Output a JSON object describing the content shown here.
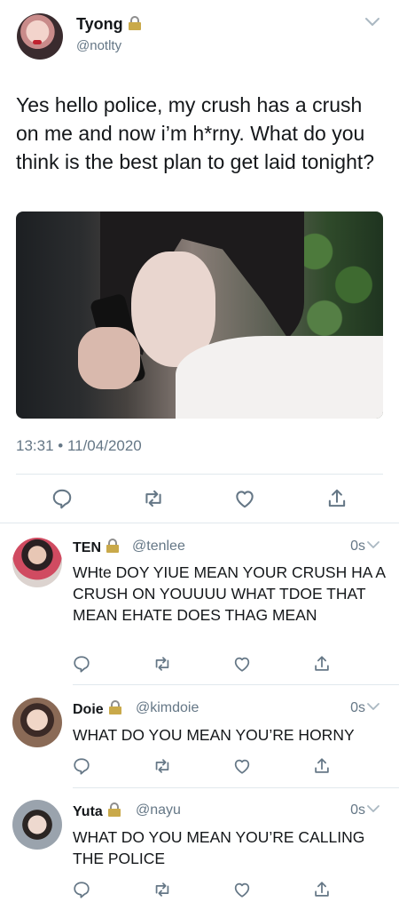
{
  "tweet": {
    "author_name": "Tyong",
    "author_handle": "@notlty",
    "text": "Yes hello police, my crush has a crush on me and now i’m h*rny. What do you think is the best plan to get laid tonight?",
    "timestamp": "13:31 • 11/04/2020",
    "icons": [
      "lock-icon",
      "chevron-down-icon",
      "reply-icon",
      "retweet-icon",
      "like-icon",
      "share-icon"
    ]
  },
  "replies": [
    {
      "name": "TEN",
      "handle": "@tenlee",
      "time": "0s",
      "text": "WHte DOY YIUE MEAN YOUR CRUSH HA A CRUSH ON YOUUUU WHAT TDOE THAT MEAN EHATE DOES THAG MEAN"
    },
    {
      "name": "Doie",
      "handle": "@kimdoie",
      "time": "0s",
      "text": "WHAT DO YOU MEAN YOU’RE HORNY"
    },
    {
      "name": "Yuta",
      "handle": "@nayu",
      "time": "0s",
      "text": "WHAT DO YOU MEAN YOU’RE CALLING THE POLICE"
    }
  ],
  "colors": {
    "text": "#14171a",
    "secondary": "#657786",
    "divider": "#e1e8ed",
    "icon": "#657786",
    "lock": "#c9a94a"
  }
}
